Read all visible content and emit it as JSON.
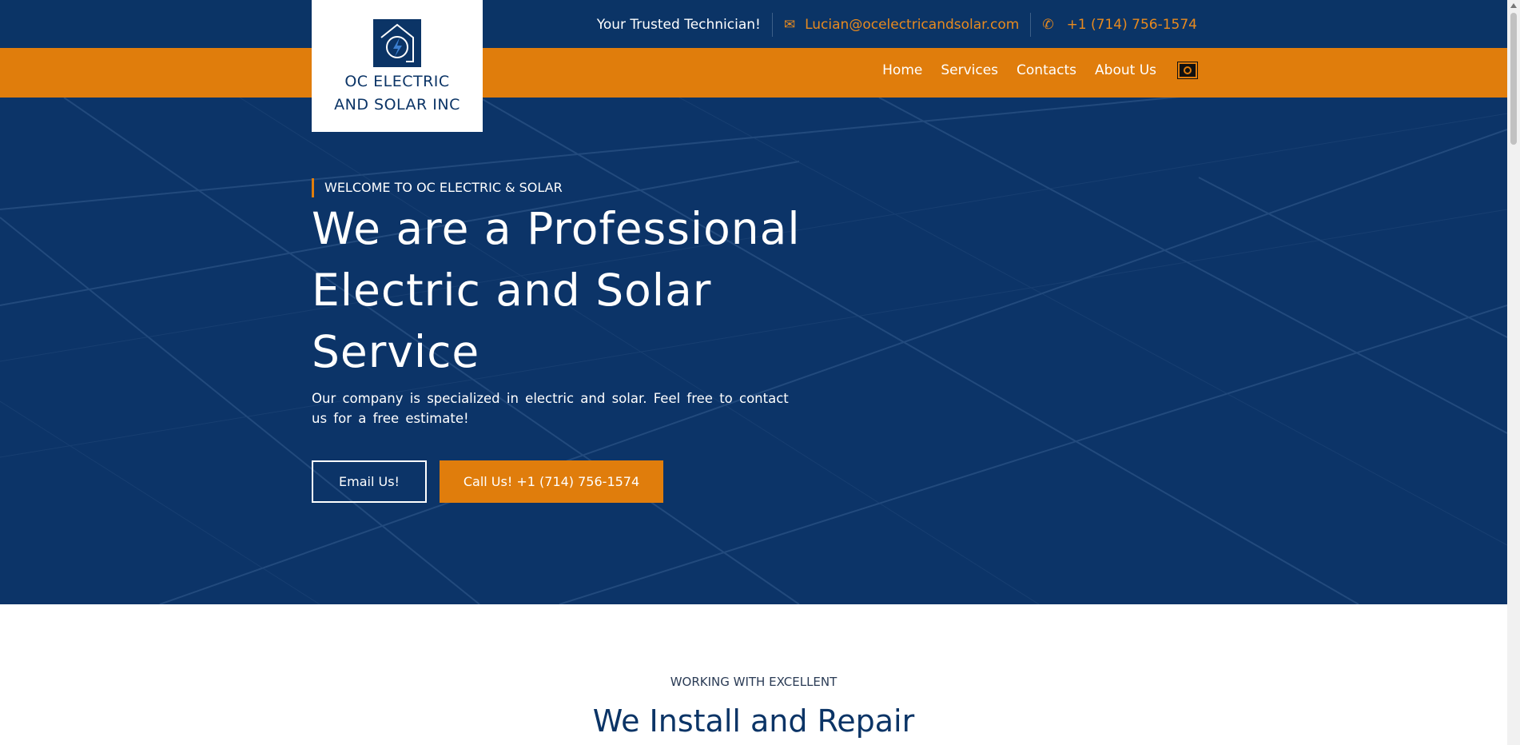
{
  "brand": {
    "line1": "OC ELECTRIC",
    "line2": "AND SOLAR INC"
  },
  "topbar": {
    "tagline": "Your Trusted Technician!",
    "email": "Lucian@ocelectricandsolar.com",
    "phone": "+1 (714) 756-1574"
  },
  "nav": {
    "items": [
      "Home",
      "Services",
      "Contacts",
      "About Us"
    ]
  },
  "hero": {
    "welcome": "WELCOME TO OC ELECTRIC & SOLAR",
    "title": "We are a Professional Electric and Solar Service",
    "text": "Our company is specialized in electric and solar. Feel free to contact us for a free estimate!",
    "email_button": "Email Us!",
    "call_button": "Call Us! +1 (714) 756-1574"
  },
  "section": {
    "subtitle": "WORKING WITH EXCELLENT",
    "title": "We Install and Repair"
  },
  "colors": {
    "navy": "#0b3466",
    "orange": "#e07d0c"
  }
}
